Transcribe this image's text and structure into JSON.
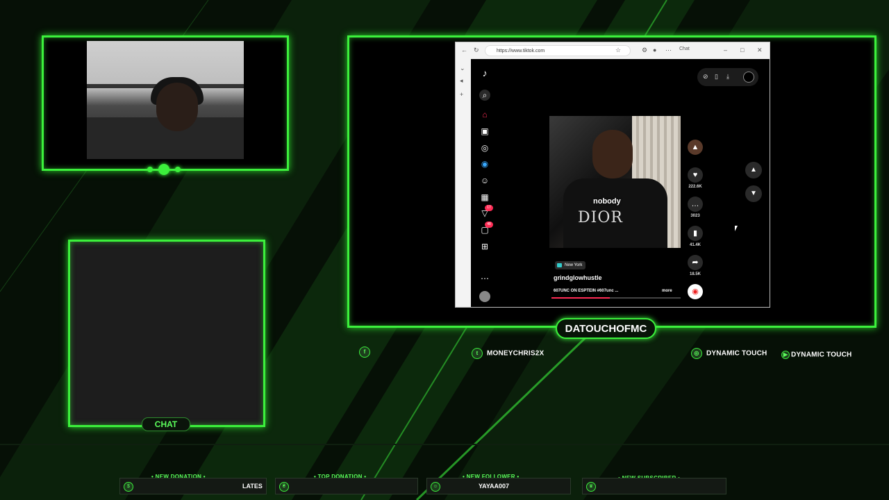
{
  "overlay": {
    "streamer_name": "DATOUCHOFMC",
    "chat_label": "CHAT",
    "accent_color": "#3cf03c",
    "socials": [
      {
        "icon": "facebook-icon",
        "label": ""
      },
      {
        "icon": "twitter-icon",
        "label": "MONEYCHRIS2X"
      },
      {
        "icon": "instagram-icon",
        "label": "DYNAMIC TOUCH"
      },
      {
        "icon": "youtube-icon",
        "label": "DYNAMIC TOUCH"
      }
    ],
    "alerts": [
      {
        "title": "NEW DONATION",
        "value": "LATES",
        "icon": "donation-icon"
      },
      {
        "title": "TOP DONATION",
        "value": "",
        "icon": "money-bag-icon"
      },
      {
        "title": "NEW FOLLOWER",
        "value": "YAYAA007",
        "icon": "user-icon"
      },
      {
        "title": "NEW SUBSCRIBER",
        "value": "",
        "icon": "crown-icon"
      }
    ]
  },
  "browser": {
    "url": "https://www.tiktok.com",
    "copilot_label": "Chat"
  },
  "tiktok": {
    "caption_overlay": "nobody",
    "shirt_text": "DIOR",
    "location": "New York",
    "username": "grindglowhustle",
    "caption": "607UNC ON ESPTEIN #607unc ...",
    "more_label": "more",
    "likes": "222.6K",
    "comments": "3023",
    "saves": "41.4K",
    "shares": "18.5K",
    "progress": 0.45,
    "nav_badges": {
      "activity": "17",
      "messages": "48"
    }
  }
}
